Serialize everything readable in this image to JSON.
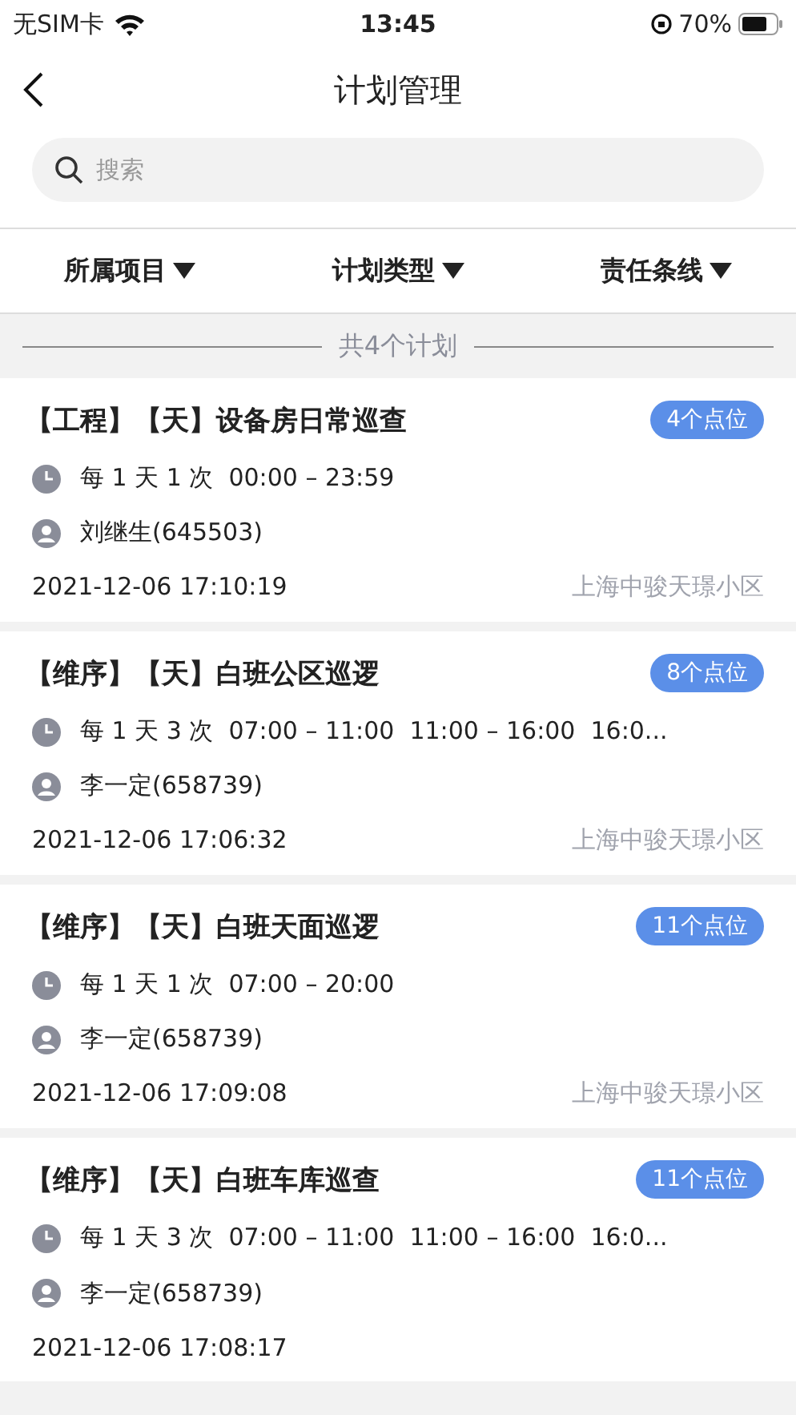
{
  "status_bar": {
    "carrier": "无SIM卡",
    "time": "13:45",
    "battery": "70%"
  },
  "nav": {
    "title": "计划管理"
  },
  "search": {
    "placeholder": "搜索"
  },
  "filters": [
    {
      "label": "所属项目"
    },
    {
      "label": "计划类型"
    },
    {
      "label": "责任条线"
    }
  ],
  "count": "共4个计划",
  "plans": [
    {
      "title": "【工程】【天】设备房日常巡查",
      "badge": "4个点位",
      "schedule": "每 1 天 1 次  00:00 – 23:59",
      "person": "刘继生(645503)",
      "datetime": "2021-12-06 17:10:19",
      "location": "上海中骏天璟小区"
    },
    {
      "title": "【维序】【天】白班公区巡逻",
      "badge": "8个点位",
      "schedule": "每 1 天 3 次  07:00 – 11:00  11:00 – 16:00  16:0...",
      "person": "李一定(658739)",
      "datetime": "2021-12-06 17:06:32",
      "location": "上海中骏天璟小区"
    },
    {
      "title": "【维序】【天】白班天面巡逻",
      "badge": "11个点位",
      "schedule": "每 1 天 1 次  07:00 – 20:00",
      "person": "李一定(658739)",
      "datetime": "2021-12-06 17:09:08",
      "location": "上海中骏天璟小区"
    },
    {
      "title": "【维序】【天】白班车库巡查",
      "badge": "11个点位",
      "schedule": "每 1 天 3 次  07:00 – 11:00  11:00 – 16:00  16:0...",
      "person": "李一定(658739)",
      "datetime": "2021-12-06 17:08:17"
    }
  ]
}
